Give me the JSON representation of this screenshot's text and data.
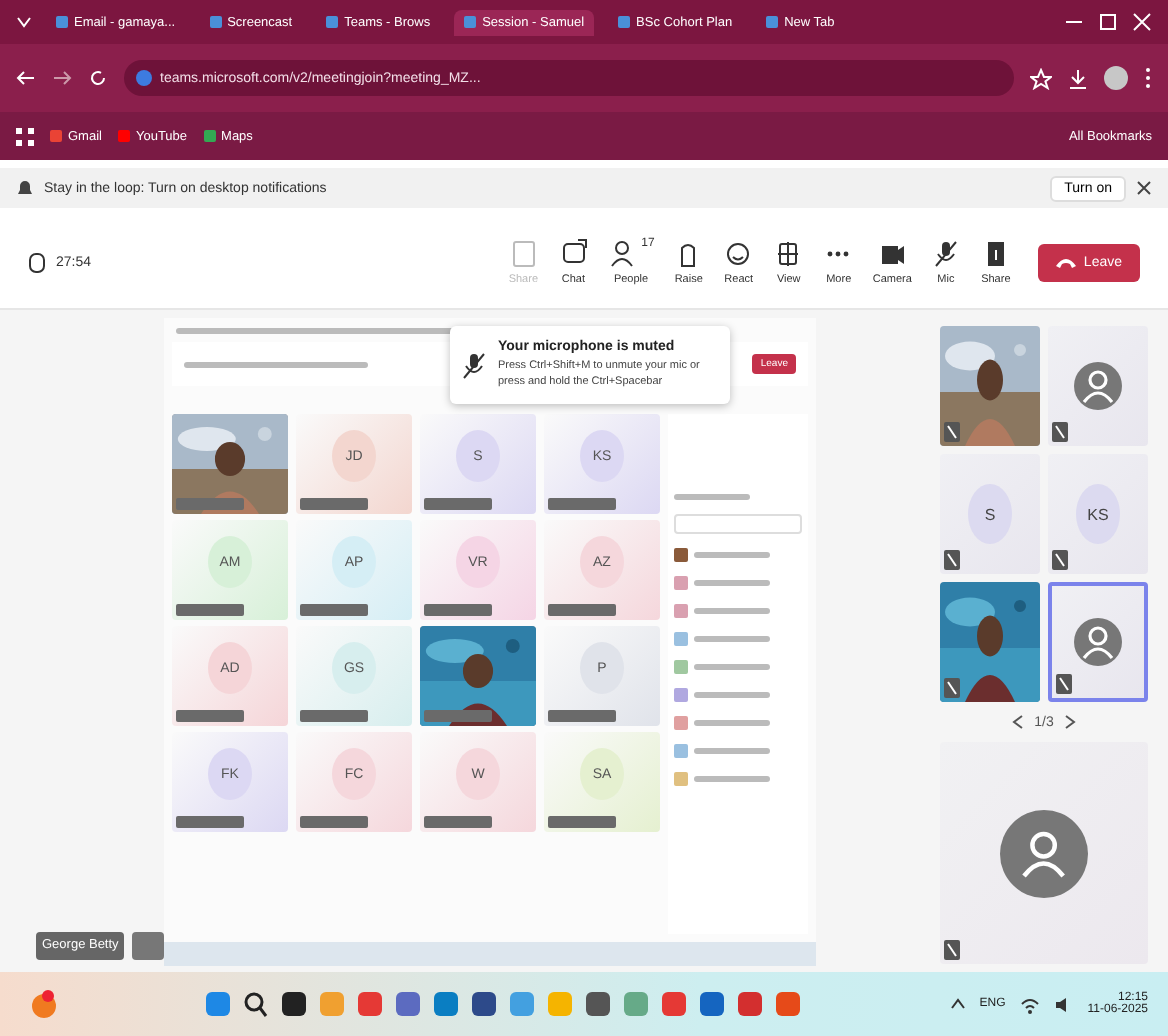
{
  "browser": {
    "tabs": [
      {
        "title": "Email - gamaya...",
        "selected": false
      },
      {
        "title": "Screencast",
        "selected": false
      },
      {
        "title": "Teams - Brows",
        "selected": false
      },
      {
        "title": "Session - Samuel",
        "selected": true
      },
      {
        "title": "BSc Cohort Plan",
        "selected": false
      },
      {
        "title": "New Tab",
        "selected": false
      }
    ],
    "url": "teams.microsoft.com/v2/meetingjoin?meeting_MZ...",
    "bookmarks": [
      "Gmail",
      "YouTube",
      "Maps"
    ],
    "all_bookmarks": "All Bookmarks"
  },
  "notice": {
    "text": "Stay in the loop: Turn on desktop notifications",
    "button": "Turn on"
  },
  "toolbar": {
    "timer": "27:54",
    "buttons": [
      {
        "kind": "share",
        "label": "Share",
        "disabled": true
      },
      {
        "kind": "chat",
        "label": "Chat",
        "disabled": false
      },
      {
        "kind": "people",
        "label": "People",
        "disabled": false,
        "count": "17"
      },
      {
        "kind": "hand",
        "label": "Raise",
        "disabled": false
      },
      {
        "kind": "smile",
        "label": "React",
        "disabled": false
      },
      {
        "kind": "grid",
        "label": "View",
        "disabled": false
      },
      {
        "kind": "more",
        "label": "More",
        "disabled": false
      },
      {
        "kind": "camera",
        "label": "Camera",
        "disabled": false
      },
      {
        "kind": "mic",
        "label": "Mic",
        "disabled": false
      },
      {
        "kind": "upload",
        "label": "Share",
        "disabled": false
      }
    ],
    "leave": "Leave"
  },
  "shared_screen": {
    "leave": "Leave",
    "tiles": [
      {
        "kind": "picture"
      },
      {
        "kind": "initials",
        "initials": "JD",
        "color": "#f3d6cf"
      },
      {
        "kind": "initials",
        "initials": "S",
        "color": "#dcd8f3"
      },
      {
        "kind": "initials",
        "initials": "KS",
        "color": "#dcd8f3"
      },
      {
        "kind": "initials",
        "initials": "AM",
        "color": "#d7f0d8"
      },
      {
        "kind": "initials",
        "initials": "AP",
        "color": "#d5eef5"
      },
      {
        "kind": "initials",
        "initials": "VR",
        "color": "#f5d5e5"
      },
      {
        "kind": "initials",
        "initials": "AZ",
        "color": "#f5d7dc"
      },
      {
        "kind": "initials",
        "initials": "AD",
        "color": "#f5d5d8"
      },
      {
        "kind": "initials",
        "initials": "GS",
        "color": "#d7eeee"
      },
      {
        "kind": "picture"
      },
      {
        "kind": "initials",
        "initials": "P",
        "color": "#e0e3ea"
      },
      {
        "kind": "initials",
        "initials": "FK",
        "color": "#dcd8f3"
      },
      {
        "kind": "initials",
        "initials": "FC",
        "color": "#f5d7dc"
      },
      {
        "kind": "initials",
        "initials": "W",
        "color": "#f5d7dc"
      },
      {
        "kind": "initials",
        "initials": "SA",
        "color": "#e5f0d0"
      }
    ],
    "participants": [
      {
        "color": "#8a5a3a"
      },
      {
        "color": "#d9a0b0"
      },
      {
        "color": "#d9a0b0"
      },
      {
        "color": "#9ac0e0"
      },
      {
        "color": "#a0c8a0"
      },
      {
        "color": "#b0a8e0"
      },
      {
        "color": "#e0a0a0"
      },
      {
        "color": "#9ac0e0"
      },
      {
        "color": "#e0c080"
      }
    ]
  },
  "toast": {
    "title": "Your microphone is muted",
    "text": "Press Ctrl+Shift+M to unmute your mic or press and hold the Ctrl+Spacebar"
  },
  "gallery": {
    "tiles": [
      {
        "kind": "picture",
        "selected": false
      },
      {
        "kind": "avatar",
        "selected": false
      },
      {
        "kind": "initials",
        "initials": "S",
        "selected": false
      },
      {
        "kind": "initials",
        "initials": "KS",
        "selected": false
      },
      {
        "kind": "picture",
        "selected": false
      },
      {
        "kind": "avatar",
        "selected": true
      }
    ],
    "pager": "1/3"
  },
  "self_name": "George Betty",
  "taskbar": {
    "language": "ENG",
    "time": "12:15",
    "date": "11-06-2025"
  }
}
